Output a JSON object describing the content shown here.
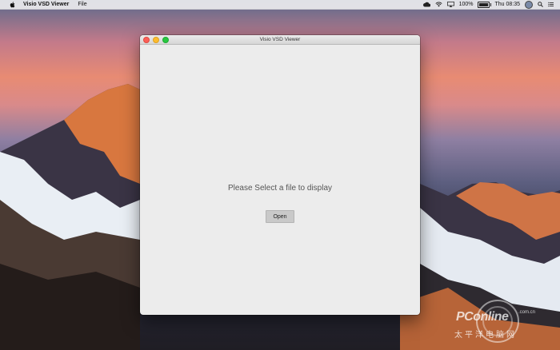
{
  "menubar": {
    "app_name": "Visio VSD Viewer",
    "menus": [
      "File"
    ],
    "battery_percent": "100%",
    "clock": "Thu 08:35",
    "status_icons": [
      "cloud-icon",
      "wifi-icon",
      "airplay-icon",
      "battery-icon",
      "avatar",
      "search-icon",
      "list-icon"
    ]
  },
  "window": {
    "title": "Visio VSD Viewer",
    "prompt": "Please Select a file to display",
    "open_button": "Open"
  },
  "watermark": {
    "brand": "PConline",
    "domain": ".com.cn",
    "chinese": "太平洋电脑网"
  }
}
